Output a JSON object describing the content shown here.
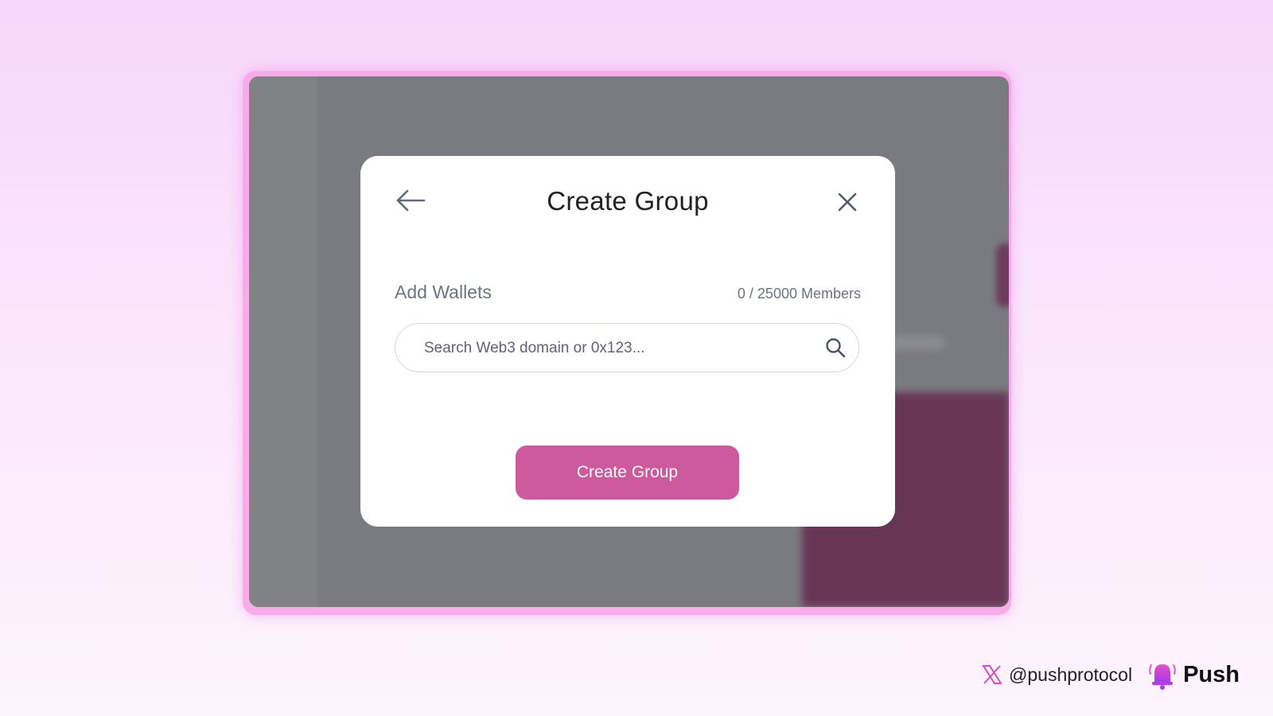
{
  "modal": {
    "title": "Create Group",
    "add_wallets_label": "Add Wallets",
    "member_count": "0 / 25000 Members",
    "search_placeholder": "Search Web3 domain or 0x123...",
    "create_button_label": "Create Group"
  },
  "footer": {
    "handle": "@pushprotocol",
    "brand": "Push"
  },
  "colors": {
    "accent": "#cc5a9c",
    "overlay": "#7a7b80",
    "frame_glow": "#f9a8ea"
  },
  "icons": {
    "back": "arrow-left-icon",
    "close": "close-icon",
    "search": "search-icon",
    "x_logo": "x-logo-icon",
    "push_logo": "push-bell-icon"
  }
}
